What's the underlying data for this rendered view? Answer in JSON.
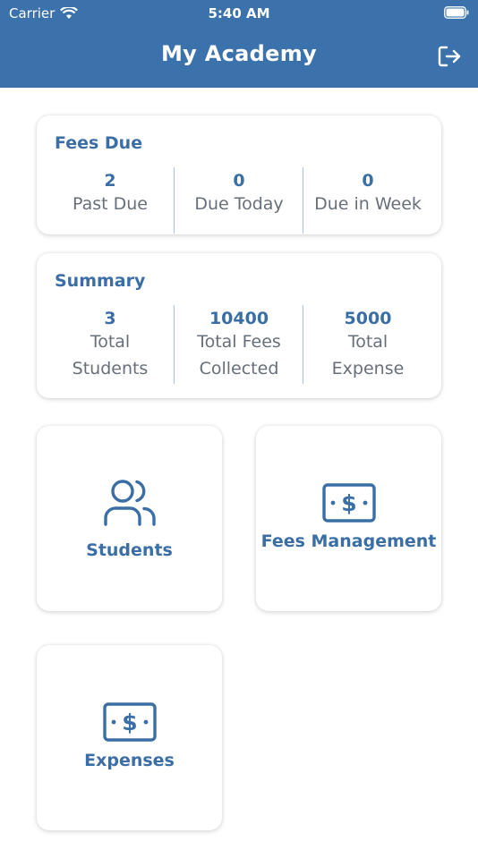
{
  "status_bar": {
    "carrier": "Carrier",
    "time": "5:40 AM"
  },
  "header": {
    "title": "My Academy"
  },
  "fees_due": {
    "title": "Fees Due",
    "stats": [
      {
        "value": "2",
        "label": "Past Due"
      },
      {
        "value": "0",
        "label": "Due Today"
      },
      {
        "value": "0",
        "label": "Due in Week"
      }
    ]
  },
  "summary": {
    "title": "Summary",
    "stats": [
      {
        "value": "3",
        "label_line1": "Total",
        "label_line2": "Students"
      },
      {
        "value": "10400",
        "label_line1": "Total Fees",
        "label_line2": "Collected"
      },
      {
        "value": "5000",
        "label_line1": "Total",
        "label_line2": "Expense"
      }
    ]
  },
  "tiles": {
    "students": "Students",
    "fees_management": "Fees Management",
    "expenses": "Expenses"
  },
  "colors": {
    "header_bg": "#3b72ab",
    "accent": "#3a6ea5",
    "label_gray": "#676f7a"
  },
  "icons": [
    "wifi-icon",
    "battery-icon",
    "logout-icon",
    "users-icon",
    "money-icon"
  ]
}
